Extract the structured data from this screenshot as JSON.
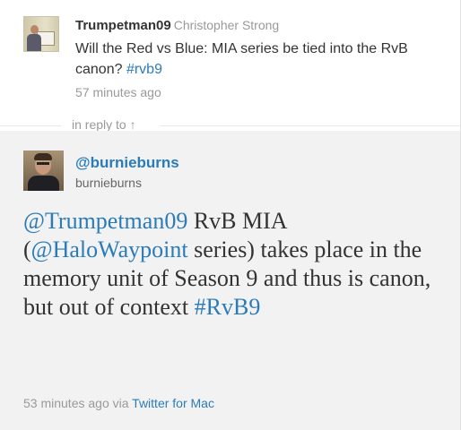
{
  "parent_tweet": {
    "username": "Trumpetman09",
    "full_name": "Christopher Strong",
    "text_before": "Will the Red vs Blue: MIA series be tied into the RvB canon? ",
    "hashtag": "#rvb9",
    "timestamp": "57 minutes ago"
  },
  "separator": {
    "label": "in reply to",
    "arrow": "↑"
  },
  "main_tweet": {
    "handle": "@burnieburns",
    "username": "burnieburns",
    "mention_1": "@Trumpetman09",
    "text_1": " RvB MIA (",
    "mention_2": "@HaloWaypoint",
    "text_2": " series) takes place in the memory unit of Season 9 and thus is canon, but out of context ",
    "hashtag": "#RvB9",
    "timestamp": "53 minutes ago",
    "via_label": "via",
    "client": "Twitter for Mac"
  },
  "colors": {
    "link": "#2b7bb9",
    "muted": "#999999",
    "text": "#333333",
    "main_bg": "#f2f2f2"
  }
}
